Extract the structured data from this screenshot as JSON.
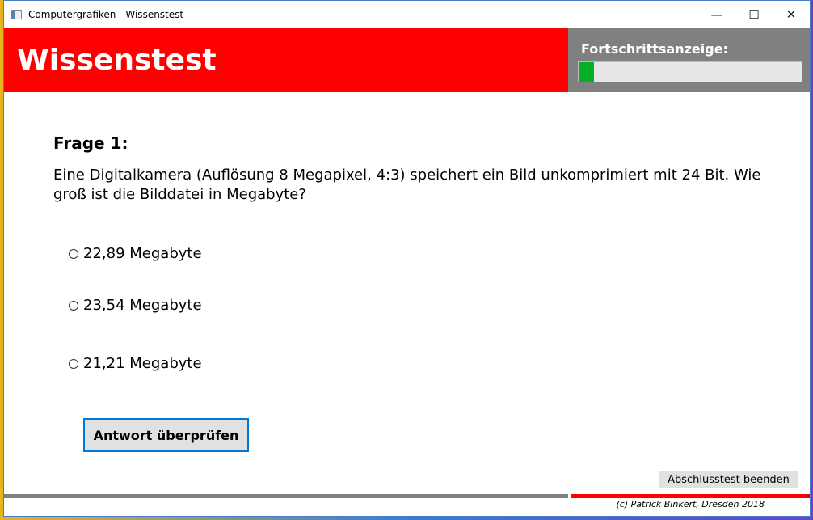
{
  "window": {
    "title": "Computergrafiken - Wissenstest",
    "controls": {
      "minimize": "—",
      "maximize": "☐",
      "close": "✕"
    }
  },
  "header": {
    "title": "Wissenstest",
    "accent_color": "#ff0000"
  },
  "progress": {
    "label": "Fortschrittsanzeige:",
    "value_fraction": 0.07,
    "fill_color": "#06b025"
  },
  "question": {
    "heading": "Frage 1:",
    "text": "Eine Digitalkamera (Auflösung 8 Megapixel, 4:3) speichert ein Bild unkomprimiert mit 24 Bit. Wie groß ist die Bilddatei in Megabyte?",
    "options": [
      {
        "label": "22,89 Megabyte",
        "selected": false
      },
      {
        "label": "23,54 Megabyte",
        "selected": false
      },
      {
        "label": "21,21 Megabyte",
        "selected": false
      }
    ]
  },
  "actions": {
    "check_label": "Antwort überprüfen",
    "end_label": "Abschlusstest beenden"
  },
  "footer": {
    "copyright": "(c) Patrick Binkert, Dresden 2018"
  }
}
